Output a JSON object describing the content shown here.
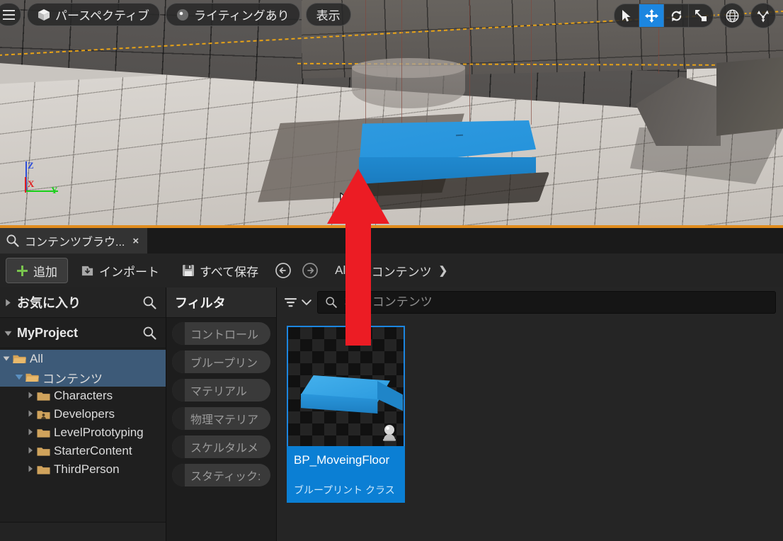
{
  "viewport": {
    "toolbar_left": [
      {
        "name": "menu",
        "icon": "hamburger-icon",
        "label": ""
      },
      {
        "name": "perspective",
        "icon": "cube-icon",
        "label": "パースペクティブ"
      },
      {
        "name": "lit",
        "icon": "lighting-icon",
        "label": "ライティングあり"
      },
      {
        "name": "show",
        "icon": "",
        "label": "表示"
      }
    ],
    "transform_tools": [
      {
        "name": "select",
        "icon": "arrow-cursor-icon",
        "active": false
      },
      {
        "name": "move",
        "icon": "move-gizmo-icon",
        "active": true
      },
      {
        "name": "rotate",
        "icon": "rotate-gizmo-icon",
        "active": false
      },
      {
        "name": "scale",
        "icon": "scale-gizmo-icon",
        "active": false
      }
    ],
    "coord_space": {
      "name": "world-coordinate",
      "icon": "globe-icon"
    },
    "snap_settings": {
      "name": "surface-snapping",
      "icon": "snap-icon"
    },
    "axis_gizmo": {
      "z": "Z",
      "x": "X",
      "y": "Y",
      "z_color": "#2f4fd8",
      "x_color": "#e02020",
      "y_color": "#18d018"
    },
    "focus_border_color": "#e08c1e",
    "platform_color": "#2492da"
  },
  "content_browser": {
    "tab": {
      "label": "コンテンツブラウ...",
      "icon": "content-browser-icon",
      "close": "×"
    },
    "toolbar": {
      "add_label": "追加",
      "import_label": "インポート",
      "save_all_label": "すべて保存",
      "back_icon": "arrow-left-circle-icon",
      "forward_icon": "arrow-right-circle-icon"
    },
    "breadcrumb": [
      {
        "label": "All"
      },
      {
        "label": "コンテンツ"
      }
    ],
    "breadcrumb_separator": "❯",
    "sources": {
      "favorites": {
        "label": "お気に入り",
        "expanded": false,
        "search_icon": "search-icon"
      },
      "project": {
        "label": "MyProject",
        "expanded": true,
        "search_icon": "search-icon"
      },
      "tree": [
        {
          "label": "All",
          "depth": 0,
          "expanded": true,
          "selected": false,
          "icon": "folder-open-icon"
        },
        {
          "label": "コンテンツ",
          "depth": 1,
          "expanded": true,
          "selected": true,
          "icon": "folder-open-icon"
        },
        {
          "label": "Characters",
          "depth": 2,
          "expanded": false,
          "selected": false,
          "icon": "folder-icon"
        },
        {
          "label": "Developers",
          "depth": 2,
          "expanded": false,
          "selected": false,
          "icon": "folder-developer-icon"
        },
        {
          "label": "LevelPrototyping",
          "depth": 2,
          "expanded": false,
          "selected": false,
          "icon": "folder-icon"
        },
        {
          "label": "StarterContent",
          "depth": 2,
          "expanded": false,
          "selected": false,
          "icon": "folder-icon"
        },
        {
          "label": "ThirdPerson",
          "depth": 2,
          "expanded": false,
          "selected": false,
          "icon": "folder-icon"
        }
      ]
    },
    "filters": {
      "title": "フィルタ",
      "chips": [
        {
          "label": "コントロール"
        },
        {
          "label": "ブループリン"
        },
        {
          "label": "マテリアル"
        },
        {
          "label": "物理マテリア"
        },
        {
          "label": "スケルタルメ"
        },
        {
          "label": "スタティック:"
        }
      ]
    },
    "assets_bar": {
      "filter_icon": "filter-funnel-icon",
      "chevron_icon": "chevron-down-icon",
      "search_icon": "search-icon",
      "search_placeholder": "検索 コンテンツ",
      "search_value": ""
    },
    "assets": [
      {
        "name": "BP_MoveingFloor",
        "type": "ブループリント クラス",
        "selected": true,
        "badge_icon": "blueprint-class-icon",
        "accent": "#0b7fd4"
      }
    ]
  },
  "overlays": {
    "cursor": {
      "icon": "mouse-pointer-icon"
    },
    "annotation_arrow": {
      "icon": "up-arrow-annotation",
      "color": "#ec1c24"
    }
  }
}
